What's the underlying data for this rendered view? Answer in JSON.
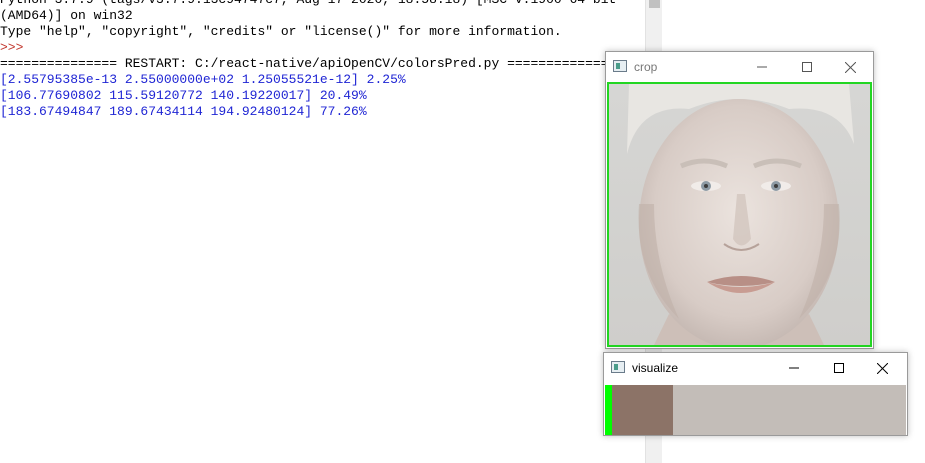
{
  "shell": {
    "lines": [
      {
        "text": "Python 3.7.9 (tags/v3.7.9:13c94747c7, Aug 17 2020, 18:58:18) [MSC v.1900 64 bit",
        "style": "normal"
      },
      {
        "text": "(AMD64)] on win32",
        "style": "normal"
      },
      {
        "text": "Type \"help\", \"copyright\", \"credits\" or \"license()\" for more information.",
        "style": "normal"
      },
      {
        "text": ">>>",
        "style": "prompt"
      },
      {
        "text": "=============== RESTART: C:/react-native/apiOpenCV/colorsPred.py ===============",
        "style": "normal"
      },
      {
        "text": "[2.55795385e-13 2.55000000e+02 1.25055521e-12] 2.25%",
        "style": "blue"
      },
      {
        "text": "[106.77690802 115.59120772 140.19220017] 20.49%",
        "style": "blue"
      },
      {
        "text": "[183.67494847 189.67434114 194.92480124] 77.26%",
        "style": "blue"
      }
    ]
  },
  "crop_window": {
    "title": "crop",
    "controls": {
      "minimize": "minimize-icon",
      "maximize": "maximize-icon",
      "close": "close-icon"
    },
    "border_color": "#22d622"
  },
  "visualize_window": {
    "title": "visualize",
    "controls": {
      "minimize": "minimize-icon",
      "maximize": "maximize-icon",
      "close": "close-icon"
    },
    "swatches": [
      {
        "color": "#00ff00",
        "percent": 2.25
      },
      {
        "color": "#8c7367",
        "percent": 20.49
      },
      {
        "color": "#c3bdb8",
        "percent": 77.26
      }
    ]
  }
}
